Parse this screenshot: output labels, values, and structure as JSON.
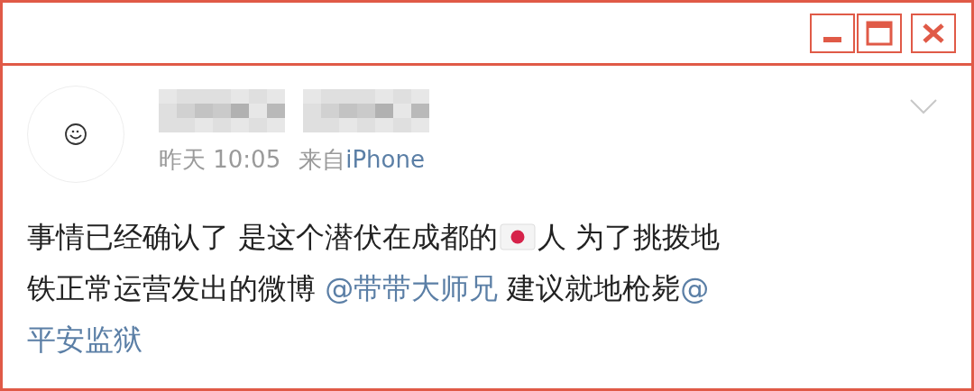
{
  "window": {
    "controls": [
      {
        "kind": "minimize"
      },
      {
        "kind": "maximize"
      },
      {
        "kind": "close"
      }
    ]
  },
  "post": {
    "name_redacted": true,
    "time": "昨天 10:05",
    "source_prefix": "来自",
    "source": "iPhone",
    "body": [
      [
        {
          "kind": "text",
          "text": "事情已经确认了 是这个潜伏在成都的"
        },
        {
          "kind": "flag"
        },
        {
          "kind": "text",
          "text": "人 为了挑拨地"
        }
      ],
      [
        {
          "kind": "text",
          "text": "铁正常运营发出的微博 "
        },
        {
          "kind": "mention",
          "text": "@带带大师兄"
        },
        {
          "kind": "text",
          "text": " 建议就地枪毙"
        },
        {
          "kind": "mention",
          "text": "@"
        }
      ],
      [
        {
          "kind": "mention",
          "text": "平安监狱"
        }
      ]
    ]
  }
}
